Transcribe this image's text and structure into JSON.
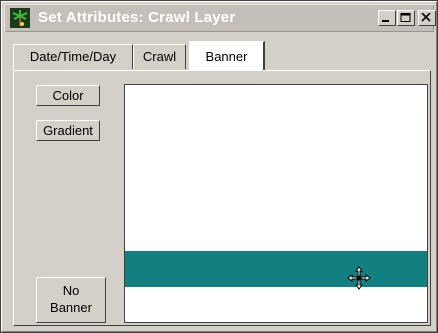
{
  "window": {
    "title": "Set Attributes: Crawl Layer"
  },
  "tabs": [
    {
      "label": "Date/Time/Day",
      "selected": false
    },
    {
      "label": "Crawl",
      "selected": false
    },
    {
      "label": "Banner",
      "selected": true
    }
  ],
  "buttons": {
    "color_label": "Color",
    "gradient_label": "Gradient",
    "no_banner_line1": "No",
    "no_banner_line2": "Banner"
  },
  "preview": {
    "banner_color": "#128080",
    "background_color": "#ffffff"
  },
  "icons": {
    "app": "palm-tree-icon",
    "minimize": "minimize-icon",
    "maximize": "maximize-icon",
    "close": "close-icon",
    "cursor": "move-cursor-icon"
  }
}
